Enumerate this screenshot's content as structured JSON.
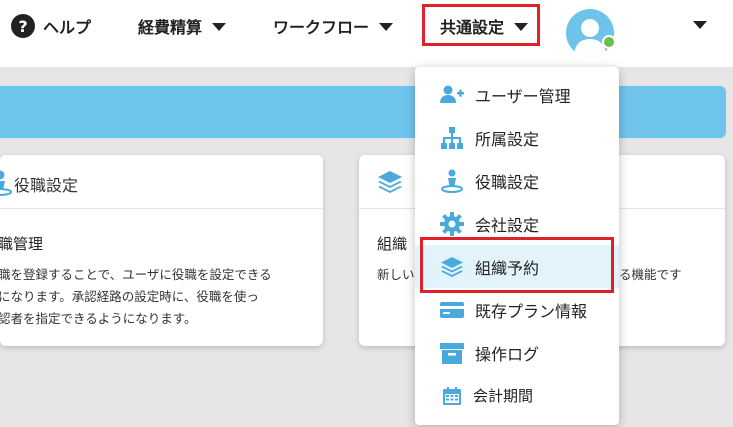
{
  "header": {
    "help_label": "ヘルプ",
    "help_glyph": "?",
    "nav": [
      {
        "label": "経費精算"
      },
      {
        "label": "ワークフロー"
      },
      {
        "label": "共通設定"
      }
    ],
    "highlight_color": "#e0202a",
    "avatar_color": "#6ec3eb",
    "status_color": "#6cc04a"
  },
  "banner": {
    "color": "#6fc4ee"
  },
  "cards": [
    {
      "title": "役職設定",
      "subtitle": "職管理",
      "desc": [
        "職を登録することで、ユーザに役職を設定できる",
        "になります。承認経路の設定時に、役職を使っ",
        "認者を指定できるようになります。"
      ]
    },
    {
      "title": "",
      "subtitle": "組織",
      "desc": [
        "新しい",
        "る機能です"
      ]
    }
  ],
  "dropdown": {
    "items": [
      {
        "label": "ユーザー管理",
        "icon": "user-plus-icon"
      },
      {
        "label": "所属設定",
        "icon": "org-chart-icon"
      },
      {
        "label": "役職設定",
        "icon": "person-pin-icon"
      },
      {
        "label": "会社設定",
        "icon": "gear-icon"
      },
      {
        "label": "組織予約",
        "icon": "layers-icon"
      },
      {
        "label": "既存プラン情報",
        "icon": "card-icon"
      },
      {
        "label": "操作ログ",
        "icon": "archive-icon"
      },
      {
        "label": "会計期間",
        "icon": "calendar-icon"
      }
    ],
    "icon_color": "#4aa9dc",
    "active_item": "組織予約"
  }
}
